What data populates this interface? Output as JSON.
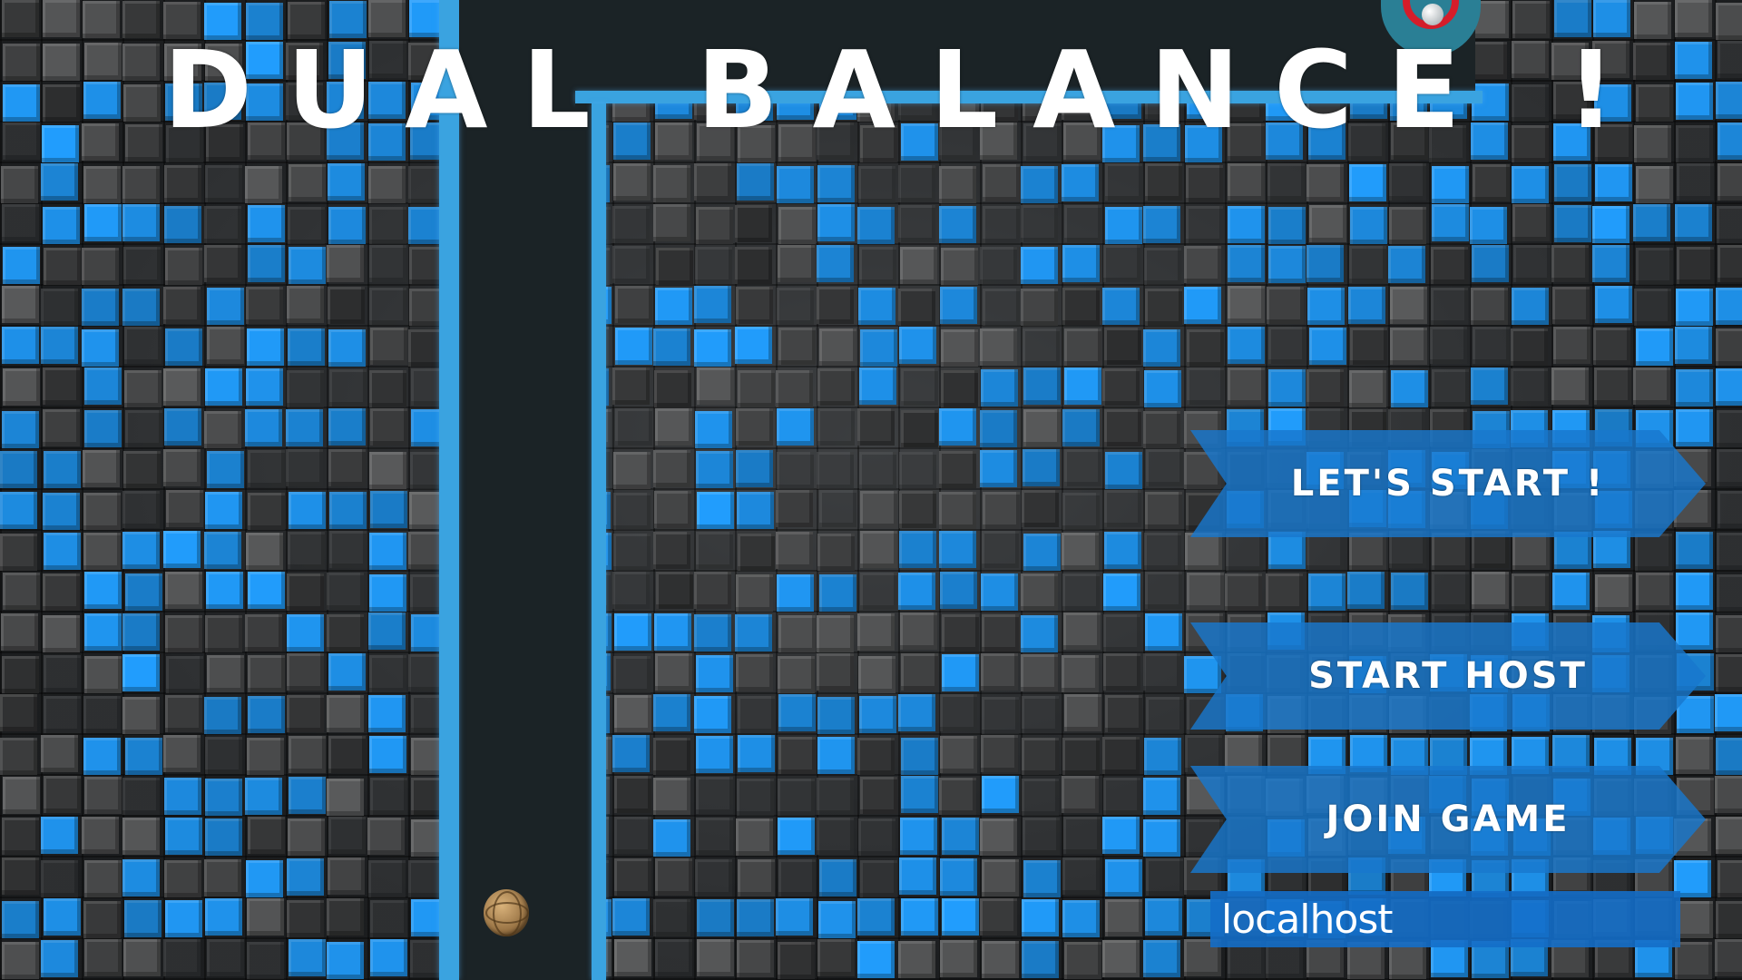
{
  "game": {
    "title": "DUAL BALANCE !"
  },
  "menu": {
    "start_label": "LET'S START !",
    "host_label": "START HOST",
    "join_label": "JOIN GAME",
    "address_value": "localhost"
  },
  "colors": {
    "button_fill": "#1878cd",
    "platform_edge": "#3aa3e0",
    "cube_blue": "#1e8fe6",
    "cube_dark": "#3a3c3e"
  },
  "icons": {
    "target": "target-goal-icon",
    "player": "wooden-ball-icon"
  }
}
